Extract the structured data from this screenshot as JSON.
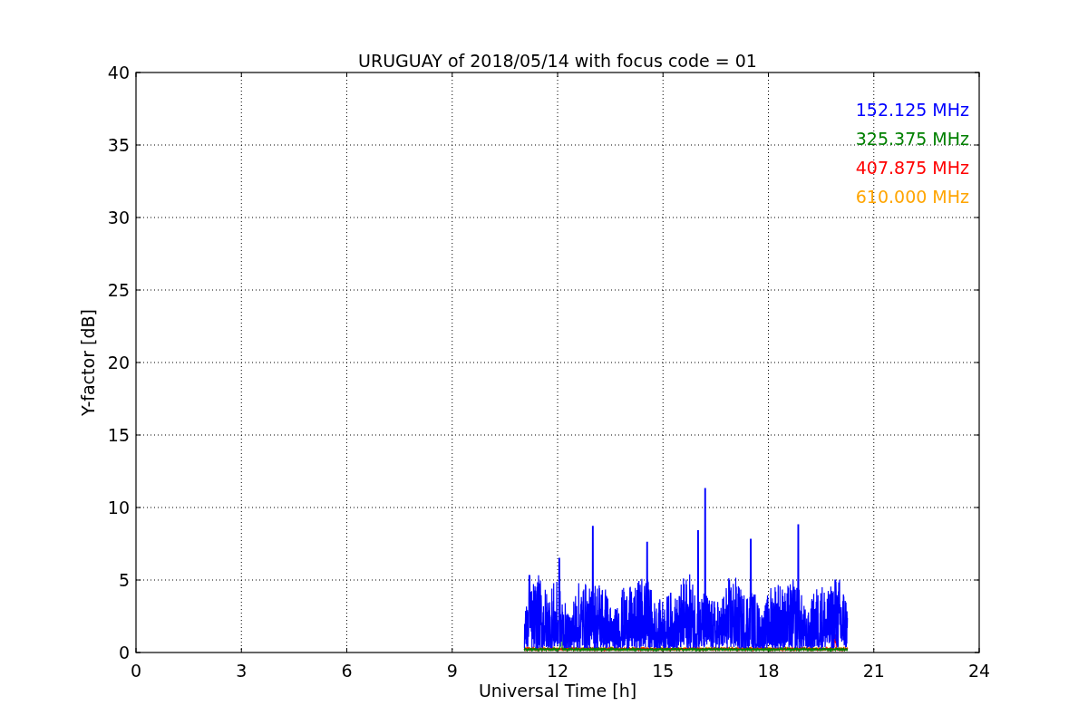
{
  "chart": {
    "title": "URUGUAY of 2018/05/14 with focus code = 01",
    "xlabel": "Universal Time [h]",
    "ylabel": "Y-factor [dB]",
    "xticks": [
      "0",
      "3",
      "6",
      "9",
      "12",
      "15",
      "18",
      "21",
      "24"
    ],
    "yticks": [
      "40",
      "35",
      "30",
      "25",
      "20",
      "15",
      "10",
      "5",
      "0"
    ],
    "legend": [
      {
        "label": "152.125 MHz",
        "color": "#0000ff"
      },
      {
        "label": "325.375 MHz",
        "color": "#008000"
      },
      {
        "label": "407.875 MHz",
        "color": "#ff0000"
      },
      {
        "label": "610.000 MHz",
        "color": "#ffa500"
      }
    ]
  }
}
